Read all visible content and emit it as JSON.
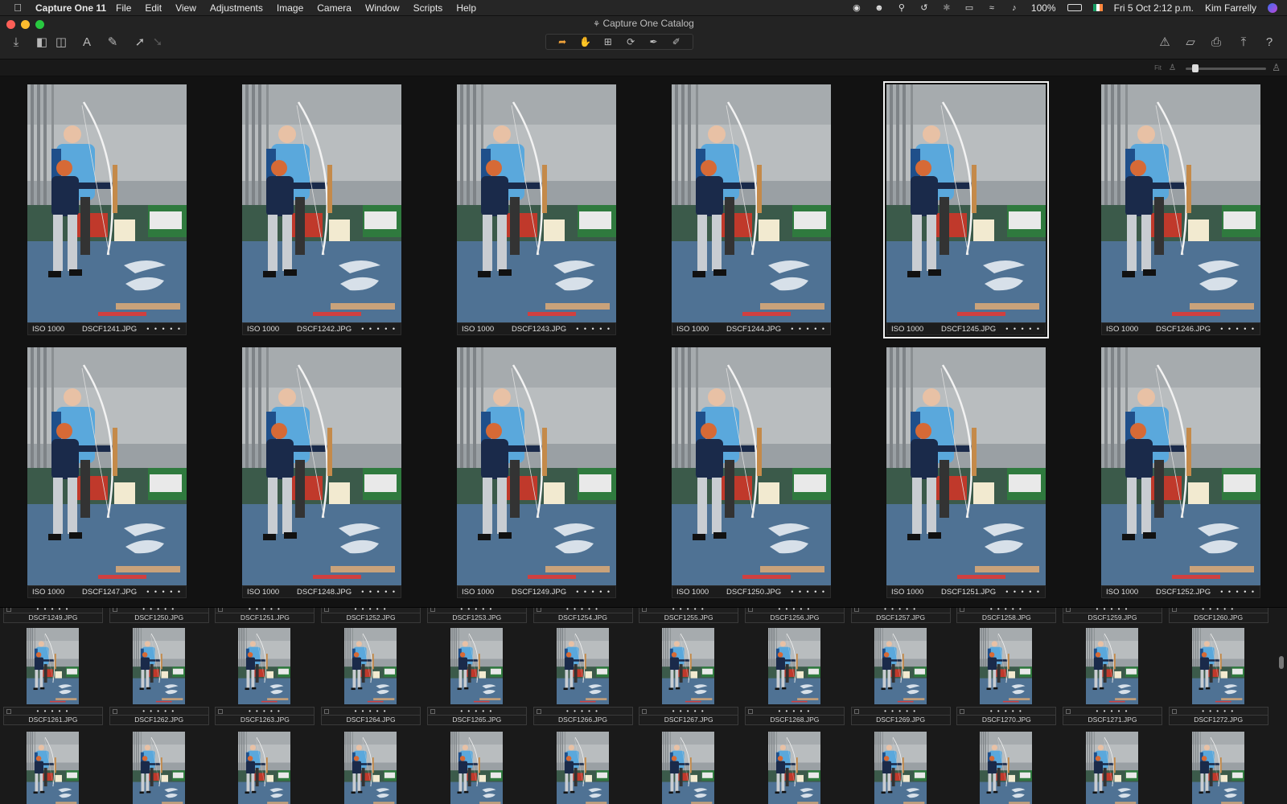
{
  "menubar": {
    "app_name": "Capture One 11",
    "menus": [
      "File",
      "Edit",
      "View",
      "Adjustments",
      "Image",
      "Camera",
      "Window",
      "Scripts",
      "Help"
    ],
    "status": {
      "battery": "100%",
      "datetime": "Fri 5 Oct  2:12 p.m.",
      "user": "Kim Farrelly"
    }
  },
  "window": {
    "title": "Capture One Catalog"
  },
  "viewer": {
    "fit_label": "Fit",
    "images": [
      {
        "iso": "ISO 1000",
        "file": "DSCF1241.JPG",
        "rating": "• • • • •",
        "selected": false
      },
      {
        "iso": "ISO 1000",
        "file": "DSCF1242.JPG",
        "rating": "• • • • •",
        "selected": false
      },
      {
        "iso": "ISO 1000",
        "file": "DSCF1243.JPG",
        "rating": "• • • • •",
        "selected": false
      },
      {
        "iso": "ISO 1000",
        "file": "DSCF1244.JPG",
        "rating": "• • • • •",
        "selected": false
      },
      {
        "iso": "ISO 1000",
        "file": "DSCF1245.JPG",
        "rating": "• • • • •",
        "selected": true
      },
      {
        "iso": "ISO 1000",
        "file": "DSCF1246.JPG",
        "rating": "• • • • •",
        "selected": false
      },
      {
        "iso": "ISO 1000",
        "file": "DSCF1247.JPG",
        "rating": "• • • • •",
        "selected": false
      },
      {
        "iso": "ISO 1000",
        "file": "DSCF1248.JPG",
        "rating": "• • • • •",
        "selected": false
      },
      {
        "iso": "ISO 1000",
        "file": "DSCF1249.JPG",
        "rating": "• • • • •",
        "selected": false
      },
      {
        "iso": "ISO 1000",
        "file": "DSCF1250.JPG",
        "rating": "• • • • •",
        "selected": false
      },
      {
        "iso": "ISO 1000",
        "file": "DSCF1251.JPG",
        "rating": "• • • • •",
        "selected": false
      },
      {
        "iso": "ISO 1000",
        "file": "DSCF1252.JPG",
        "rating": "• • • • •",
        "selected": false
      }
    ]
  },
  "browser": {
    "rating": "• • • • •",
    "row1": [
      "DSCF1249.JPG",
      "DSCF1250.JPG",
      "DSCF1251.JPG",
      "DSCF1252.JPG",
      "DSCF1253.JPG",
      "DSCF1254.JPG",
      "DSCF1255.JPG",
      "DSCF1256.JPG",
      "DSCF1257.JPG",
      "DSCF1258.JPG",
      "DSCF1259.JPG",
      "DSCF1260.JPG"
    ],
    "row2": [
      "DSCF1261.JPG",
      "DSCF1262.JPG",
      "DSCF1263.JPG",
      "DSCF1264.JPG",
      "DSCF1265.JPG",
      "DSCF1266.JPG",
      "DSCF1267.JPG",
      "DSCF1268.JPG",
      "DSCF1269.JPG",
      "DSCF1270.JPG",
      "DSCF1271.JPG",
      "DSCF1272.JPG"
    ],
    "selected_in_row1": [
      "DSCF1249.JPG",
      "DSCF1250.JPG",
      "DSCF1251.JPG",
      "DSCF1252.JPG"
    ]
  },
  "colors": {
    "accent": "#f0a23a",
    "selection": "#f2f2f2",
    "panel": "#232323",
    "viewer_bg": "#121212"
  }
}
